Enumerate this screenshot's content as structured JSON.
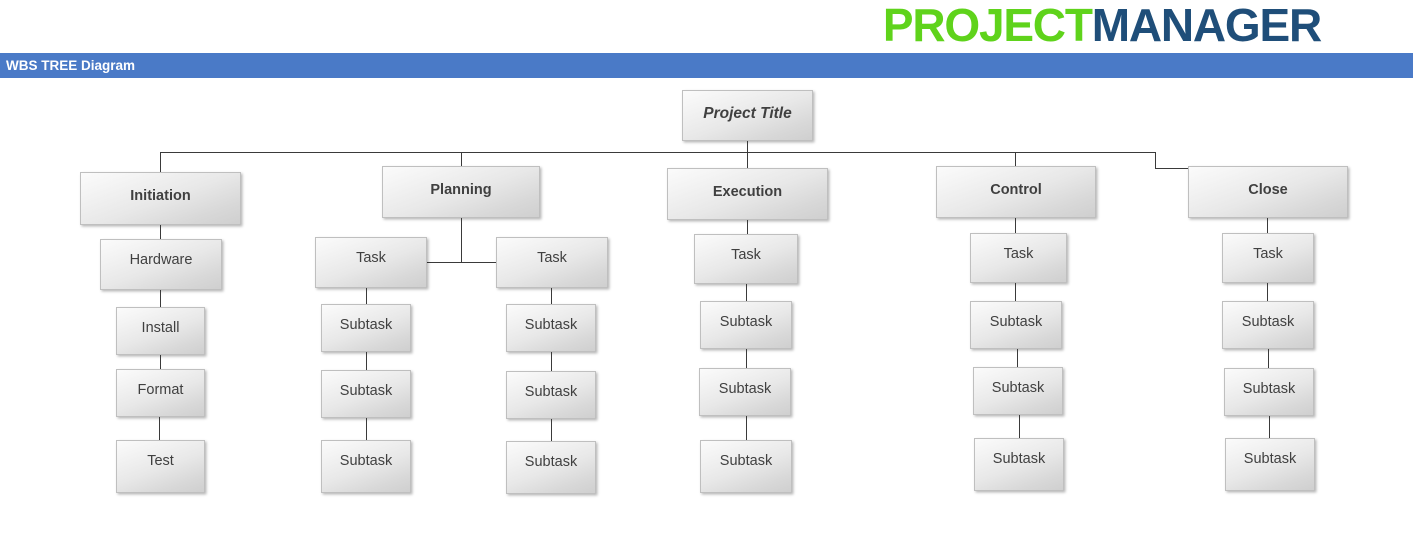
{
  "header": {
    "brand_part1": "PROJECT",
    "brand_part2": "MANAGER",
    "brand_color_1": "#5fd31b",
    "brand_color_2": "#1f4e79"
  },
  "titlebar": {
    "label": "WBS TREE Diagram",
    "background": "#4a7ac7",
    "text_color": "#ffffff"
  },
  "diagram": {
    "root": {
      "label": "Project Title"
    },
    "branches": [
      {
        "label": "Initiation",
        "children": [
          {
            "label": "Hardware"
          },
          {
            "label": "Install"
          },
          {
            "label": "Format"
          },
          {
            "label": "Test"
          }
        ]
      },
      {
        "label": "Planning",
        "columns": [
          {
            "head": {
              "label": "Task"
            },
            "children": [
              {
                "label": "Subtask"
              },
              {
                "label": "Subtask"
              },
              {
                "label": "Subtask"
              }
            ]
          },
          {
            "head": {
              "label": "Task"
            },
            "children": [
              {
                "label": "Subtask"
              },
              {
                "label": "Subtask"
              },
              {
                "label": "Subtask"
              }
            ]
          }
        ]
      },
      {
        "label": "Execution",
        "children": [
          {
            "label": "Task"
          },
          {
            "label": "Subtask"
          },
          {
            "label": "Subtask"
          },
          {
            "label": "Subtask"
          }
        ]
      },
      {
        "label": "Control",
        "children": [
          {
            "label": "Task"
          },
          {
            "label": "Subtask"
          },
          {
            "label": "Subtask"
          },
          {
            "label": "Subtask"
          }
        ]
      },
      {
        "label": "Close",
        "children": [
          {
            "label": "Task"
          },
          {
            "label": "Subtask"
          },
          {
            "label": "Subtask"
          },
          {
            "label": "Subtask"
          }
        ]
      }
    ]
  }
}
